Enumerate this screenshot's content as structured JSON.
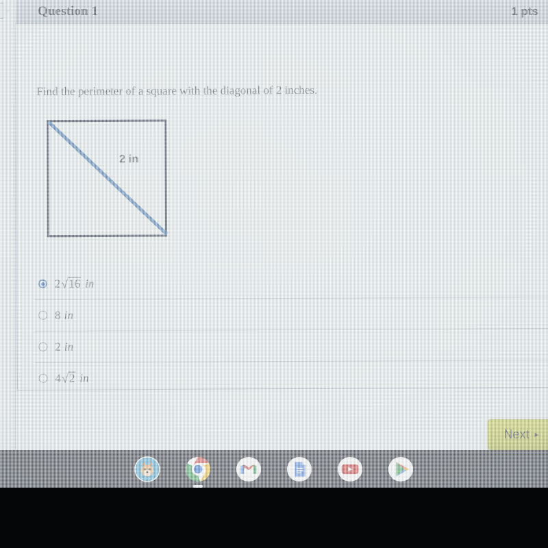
{
  "header": {
    "question_title": "Question 1",
    "points": "1 pts"
  },
  "question": {
    "text": "Find the perimeter of a square with the diagonal of 2 inches.",
    "diagram": {
      "shape": "square",
      "diagonal_label": "2 in",
      "square_stroke_color": "#1d2c4a",
      "diagonal_stroke_color": "#1c65b5"
    }
  },
  "options": [
    {
      "id": "option-a",
      "coefficient": "2",
      "radical": "16",
      "unit": "in",
      "display": "2√16 in",
      "selected": true
    },
    {
      "id": "option-b",
      "coefficient": "8",
      "radical": "",
      "unit": "in",
      "display": "8 in",
      "selected": false
    },
    {
      "id": "option-c",
      "coefficient": "2",
      "radical": "",
      "unit": "in",
      "display": "2 in",
      "selected": false
    },
    {
      "id": "option-d",
      "coefficient": "4",
      "radical": "2",
      "unit": "in",
      "display": "4√2 in",
      "selected": false
    }
  ],
  "footer": {
    "next_label": "Next",
    "next_arrow": "▸"
  },
  "taskbar": {
    "icons": [
      {
        "name": "launcher-icon",
        "label": "Launcher"
      },
      {
        "name": "chrome-icon",
        "label": "Chrome",
        "active": true
      },
      {
        "name": "gmail-icon",
        "label": "Gmail"
      },
      {
        "name": "google-docs-icon",
        "label": "Docs"
      },
      {
        "name": "youtube-icon",
        "label": "YouTube"
      },
      {
        "name": "play-store-icon",
        "label": "Play Store"
      }
    ]
  },
  "colors": {
    "page_background": "#dfe8e9",
    "header_background": "#b4c0d0",
    "accent_blue": "#1f63b4",
    "next_button": "#b6bf24",
    "taskbar": "#252a37"
  }
}
